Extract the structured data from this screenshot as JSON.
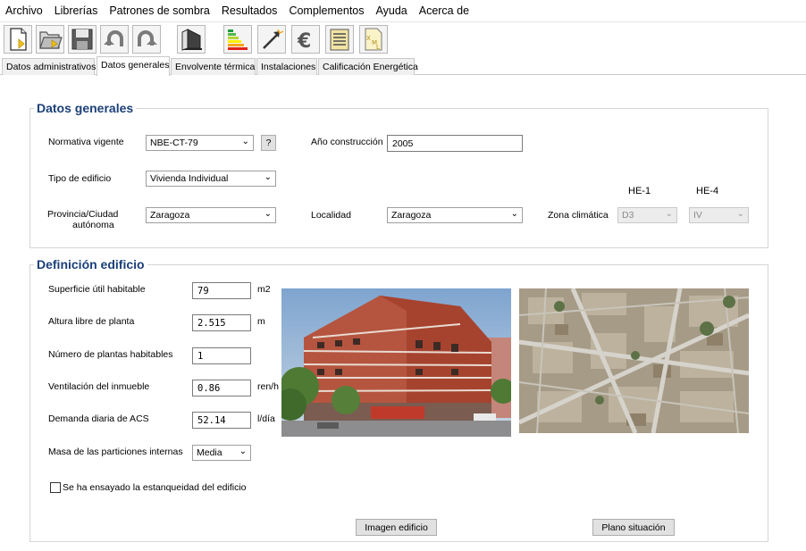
{
  "menu": [
    "Archivo",
    "Librerías",
    "Patrones de sombra",
    "Resultados",
    "Complementos",
    "Ayuda",
    "Acerca de"
  ],
  "toolbar": {
    "buttons": [
      "new-file-icon",
      "open-folder-icon",
      "save-icon",
      "undo-icon",
      "redo-icon",
      "building-icon",
      "energy-rating-icon",
      "edit-arrow-icon",
      "euro-icon",
      "document-list-icon",
      "xml-icon"
    ]
  },
  "tabs": [
    "Datos administrativos",
    "Datos generales",
    "Envolvente térmica",
    "Instalaciones",
    "Calificación Energética"
  ],
  "active_tab": "Datos generales",
  "general": {
    "title": "Datos generales",
    "normativa_label": "Normativa vigente",
    "normativa_value": "NBE-CT-79",
    "help_label": "?",
    "anio_label": "Año construcción",
    "anio_value": "2005",
    "tipo_label": "Tipo de edificio",
    "tipo_value": "Vivienda Individual",
    "provincia_label_1": "Provincia/Ciudad",
    "provincia_label_2": "autónoma",
    "provincia_value": "Zaragoza",
    "localidad_label": "Localidad",
    "localidad_value": "Zaragoza",
    "zona_label": "Zona climática",
    "he1_label": "HE-1",
    "he4_label": "HE-4",
    "he1_value": "D3",
    "he4_value": "IV"
  },
  "building": {
    "title": "Definición edificio",
    "superficie_label": "Superficie útil habitable",
    "superficie_value": "79",
    "superficie_unit": "m2",
    "altura_label": "Altura libre de planta",
    "altura_value": "2.515",
    "altura_unit": "m",
    "plantas_label": "Número de plantas habitables",
    "plantas_value": "1",
    "ventilacion_label": "Ventilación del inmueble",
    "ventilacion_value": "0.86",
    "ventilacion_unit": "ren/h",
    "acs_label": "Demanda diaria de ACS",
    "acs_value": "52.14",
    "acs_unit": "l/día",
    "masa_label": "Masa de las particiones internas",
    "masa_value": "Media",
    "estanqueidad_label": "Se ha ensayado la estanqueidad del edificio",
    "imagen_button": "Imagen edificio",
    "plano_button": "Plano situación"
  },
  "colors": {
    "group_title": "#1b3f78",
    "building_facade": "#b5553f",
    "sky": "#8fb0d4"
  }
}
